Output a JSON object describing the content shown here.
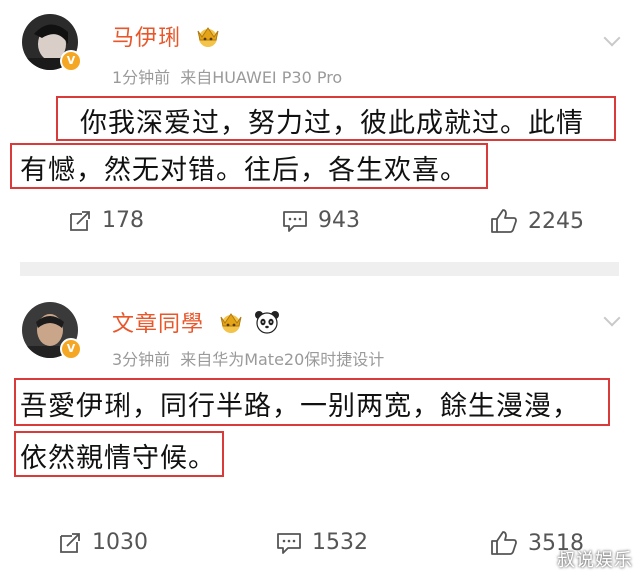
{
  "posts": [
    {
      "author": "马伊琍",
      "time": "1分钟前",
      "source": "来自HUAWEI P30 Pro",
      "lines": [
        "你我深爱过，努力过，彼此成就过。此情",
        "有憾，然无对错。往后，各生欢喜。"
      ],
      "repost_count": "178",
      "comment_count": "943",
      "like_count": "2245",
      "verified_badge": "V"
    },
    {
      "author": "文章同學",
      "time": "3分钟前",
      "source": "来自华为Mate20保时捷设计",
      "lines": [
        "吾愛伊琍，同行半路，一别两宽，餘生漫漫，",
        "依然親情守候。"
      ],
      "repost_count": "1030",
      "comment_count": "1532",
      "like_count": "3518",
      "verified_badge": "V"
    }
  ],
  "watermark": "叔说娱乐",
  "colors": {
    "name": "#e8562a",
    "highlight_box": "#d93a3a",
    "meta": "#9a9a9a",
    "divider": "#efefef"
  },
  "icons": [
    "repost-icon",
    "comment-icon",
    "like-icon",
    "chevron-down-icon",
    "crown-emoji-icon",
    "panda-emoji-icon"
  ]
}
